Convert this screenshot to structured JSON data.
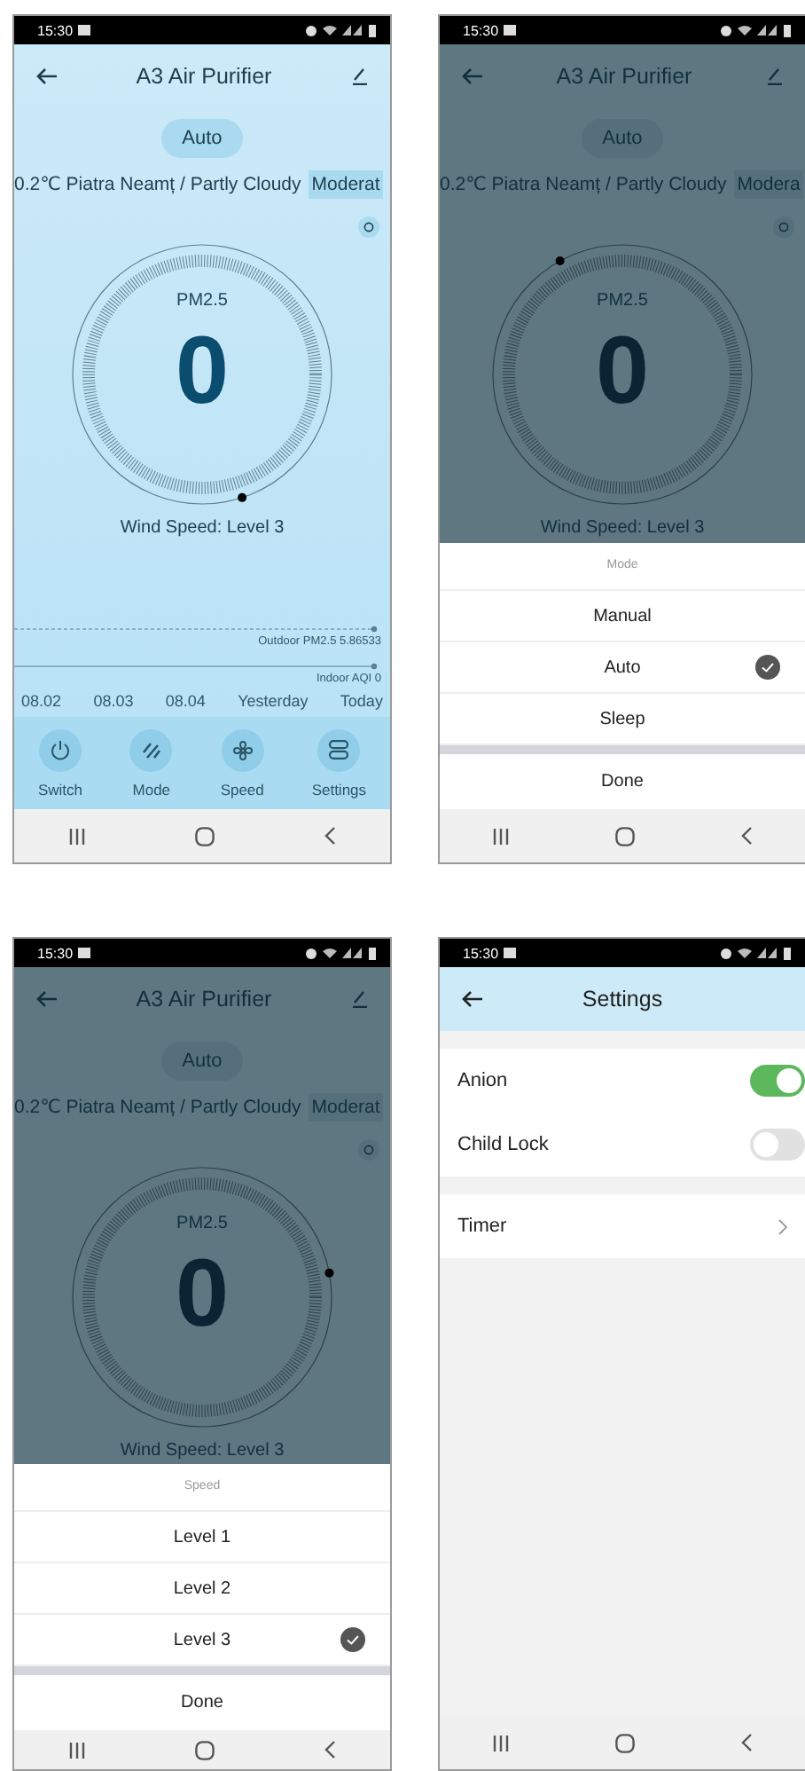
{
  "screens": [
    {
      "kind": "home",
      "status_time": "15:30",
      "title": "A3 Air Purifier",
      "mode": "Auto",
      "weather": "0.2℃ Piatra Neamț / Partly Cloudy",
      "air_quality": "Moderat",
      "dial": {
        "label": "PM2.5",
        "value": "0",
        "kind": "dot-bottom"
      },
      "wind_speed": "Wind Speed: Level 3",
      "trend": {
        "outdoor_label": "Outdoor PM2.5 5.86533",
        "indoor_label": "Indoor AQI 0",
        "dates": [
          "08.02",
          "08.03",
          "08.04",
          "Yesterday",
          "Today"
        ]
      },
      "controls": [
        {
          "kind": "power",
          "label": "Switch"
        },
        {
          "kind": "mode",
          "label": "Mode"
        },
        {
          "kind": "fan",
          "label": "Speed"
        },
        {
          "kind": "settings",
          "label": "Settings"
        }
      ]
    },
    {
      "kind": "home",
      "status_time": "15:30",
      "title": "A3 Air Purifier",
      "mode": "Auto",
      "weather": "0.2℃ Piatra Neamț / Partly Cloudy",
      "air_quality": "Modera",
      "dial": {
        "label": "PM2.5",
        "value": "0",
        "kind": "dot-upper-left"
      },
      "wind_speed": "Wind Speed: Level 3",
      "sheet": {
        "title": "Mode",
        "options": [
          {
            "label": "Manual",
            "selected": false
          },
          {
            "label": "Auto",
            "selected": true
          },
          {
            "label": "Sleep",
            "selected": false
          }
        ],
        "done": "Done"
      }
    },
    {
      "kind": "home",
      "status_time": "15:30",
      "title": "A3 Air Purifier",
      "mode": "Auto",
      "weather": "0.2℃ Piatra Neamț / Partly Cloudy",
      "air_quality": "Moderat",
      "dial": {
        "label": "PM2.5",
        "value": "0",
        "kind": "dot-right"
      },
      "wind_speed": "Wind Speed: Level 3",
      "sheet": {
        "title": "Speed",
        "options": [
          {
            "label": "Level 1",
            "selected": false
          },
          {
            "label": "Level 2",
            "selected": false
          },
          {
            "label": "Level 3",
            "selected": true
          }
        ],
        "done": "Done"
      }
    },
    {
      "kind": "settings",
      "status_time": "15:30",
      "title": "Settings",
      "groups": [
        {
          "items": [
            {
              "kind": "switch",
              "label": "Anion",
              "on": true
            },
            {
              "kind": "switch",
              "label": "Child Lock",
              "on": false
            }
          ]
        },
        {
          "items": [
            {
              "kind": "link",
              "label": "Timer"
            }
          ]
        }
      ]
    }
  ]
}
